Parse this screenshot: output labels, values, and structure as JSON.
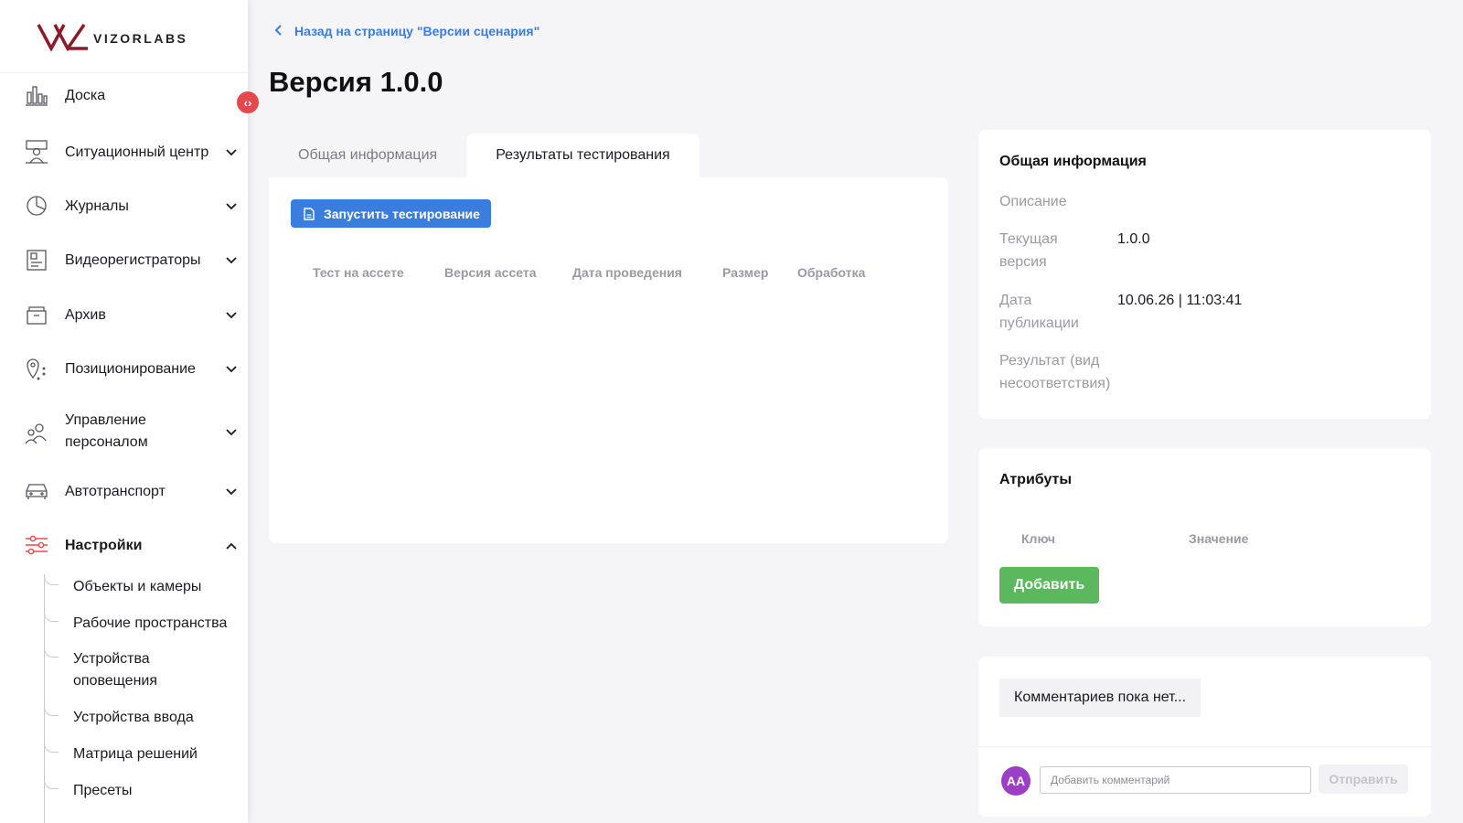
{
  "brand": {
    "name": "VIZORLABS",
    "accent": "#8b1a2a"
  },
  "sidebar": {
    "items": [
      {
        "label": "Доска",
        "icon": "dashboard-icon",
        "expandable": false
      },
      {
        "label": "Ситуационный центр",
        "icon": "monitoring-center-icon",
        "expandable": true
      },
      {
        "label": "Журналы",
        "icon": "pie-chart-icon",
        "expandable": true
      },
      {
        "label": "Видеорегистраторы",
        "icon": "video-recorder-icon",
        "expandable": true
      },
      {
        "label": "Архив",
        "icon": "archive-icon",
        "expandable": true
      },
      {
        "label": "Позиционирование",
        "icon": "location-pin-icon",
        "expandable": true
      },
      {
        "label": "Управление персоналом",
        "icon": "people-icon",
        "expandable": true
      },
      {
        "label": "Автотранспорт",
        "icon": "car-icon",
        "expandable": true
      },
      {
        "label": "Настройки",
        "icon": "sliders-icon",
        "expandable": true,
        "active": true
      }
    ],
    "subitems": [
      "Объекты и камеры",
      "Рабочие пространства",
      "Устройства оповещения",
      "Устройства ввода",
      "Матрица решений",
      "Пресеты"
    ],
    "active_color": "#e5484d"
  },
  "header": {
    "back_link": "Назад на страницу \"Версии сценария\"",
    "title": "Версия 1.0.0"
  },
  "tabs": [
    {
      "label": "Общая информация",
      "active": false
    },
    {
      "label": "Результаты тестирования",
      "active": true
    }
  ],
  "testing": {
    "run_button": "Запустить тестирование",
    "columns": [
      "Тест на ассете",
      "Версия ассета",
      "Дата проведения",
      "Размер",
      "Обработка"
    ],
    "button_color": "#3b7ddd"
  },
  "info_card": {
    "title": "Общая информация",
    "fields": [
      {
        "label": "Описание",
        "value": ""
      },
      {
        "label": "Текущая версия",
        "value": "1.0.0"
      },
      {
        "label": "Дата публикации",
        "value": "10.06.26 | 11:03:41"
      },
      {
        "label": "Результат (вид несоответствия)",
        "value": ""
      }
    ]
  },
  "attributes_card": {
    "title": "Атрибуты",
    "columns": [
      "Ключ",
      "Значение"
    ],
    "add_button": "Добавить",
    "button_color": "#5cb85c"
  },
  "comments_card": {
    "empty_text": "Комментариев пока нет...",
    "avatar_initials": "АА",
    "avatar_color": "#9b3fc4",
    "input_placeholder": "Добавить комментарий",
    "send_button": "Отправить"
  }
}
